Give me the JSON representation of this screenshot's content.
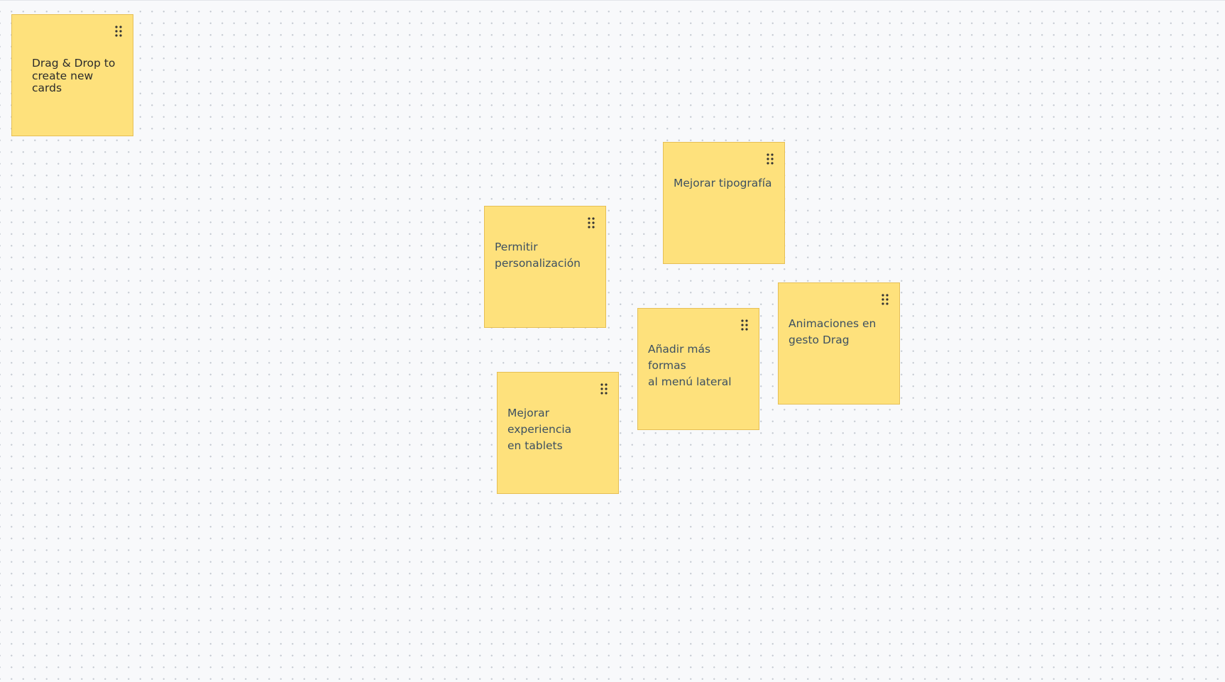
{
  "board": {
    "template_card": {
      "label": "Drag & Drop to\ncreate new\ncards",
      "handle_icon": "drag-handle-icon"
    },
    "notes": [
      {
        "text": "Mejorar tipografía"
      },
      {
        "text": "Permitir\npersonalización"
      },
      {
        "text": "Animaciones en\ngesto Drag"
      },
      {
        "text": "Añadir más formas\nal menú lateral"
      },
      {
        "text": "Mejorar experiencia\nen tablets"
      }
    ]
  },
  "colors": {
    "card_fill": "#fee17c",
    "card_border": "#e6bf55",
    "note_text": "#3d5061",
    "canvas_background": "#f8f9fb",
    "grid_dot": "#c6cbd3"
  }
}
